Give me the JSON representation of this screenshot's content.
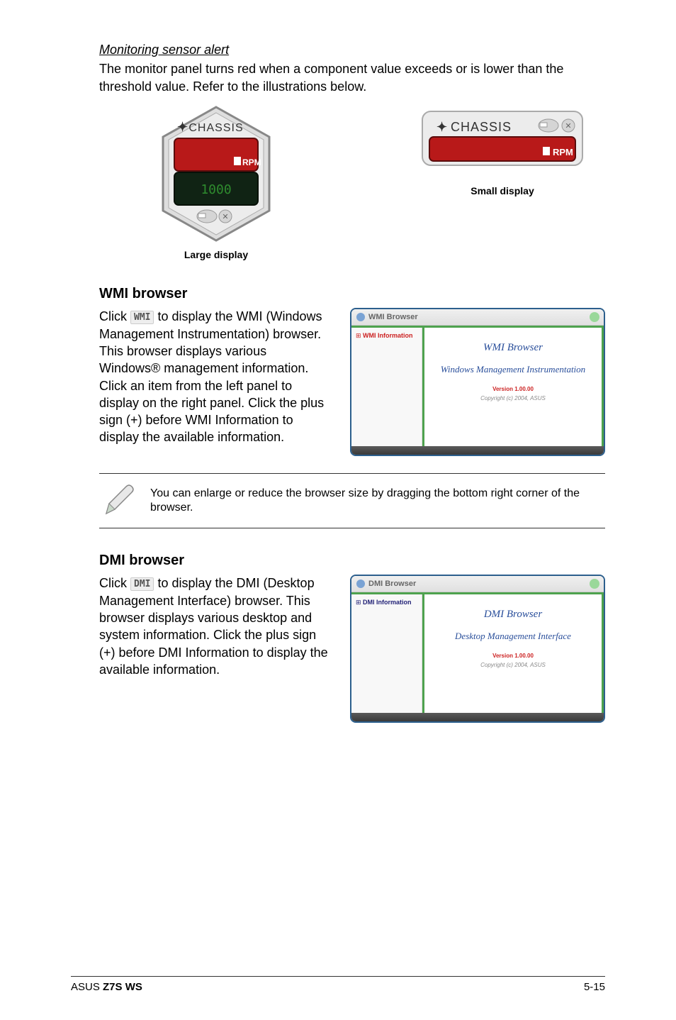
{
  "sensor": {
    "title": "Monitoring sensor alert",
    "desc": "The monitor panel turns red when a component value exceeds or is lower than the threshold value. Refer to the illustrations below."
  },
  "displays": {
    "chassis_label": "CHASSIS",
    "rpm_label": "RPM",
    "large_caption": "Large display",
    "small_caption": "Small display"
  },
  "wmi": {
    "heading": "WMI browser",
    "click": "Click ",
    "icon_name": "WMI",
    "text_after": " to display the WMI (Windows Management Instrumentation) browser. This browser displays various Windows® management information. Click an item from the left panel to display on the right panel. Click the plus sign (+) before WMI Information to display the available information.",
    "window": {
      "titlebar": "WMI Browser",
      "left_text": "WMI Information",
      "title1": "WMI Browser",
      "title2": "Windows Management Instrumentation",
      "version": "Version 1.00.00",
      "copyright": "Copyright (c) 2004, ASUS"
    }
  },
  "note": {
    "text": "You can enlarge or reduce the browser size by dragging the bottom right corner of the browser."
  },
  "dmi": {
    "heading": "DMI browser",
    "click": "Click ",
    "icon_name": "DMI",
    "text_after": " to display the DMI (Desktop Management Interface) browser. This browser displays various desktop and system information. Click the plus sign (+) before DMI Information to display the available information.",
    "window": {
      "titlebar": "DMI Browser",
      "left_text": "DMI Information",
      "title1": "DMI Browser",
      "title2": "Desktop Management Interface",
      "version": "Version 1.00.00",
      "copyright": "Copyright (c) 2004, ASUS"
    }
  },
  "footer": {
    "left_prefix": "ASUS ",
    "left_bold": "Z7S WS",
    "right": "5-15"
  }
}
